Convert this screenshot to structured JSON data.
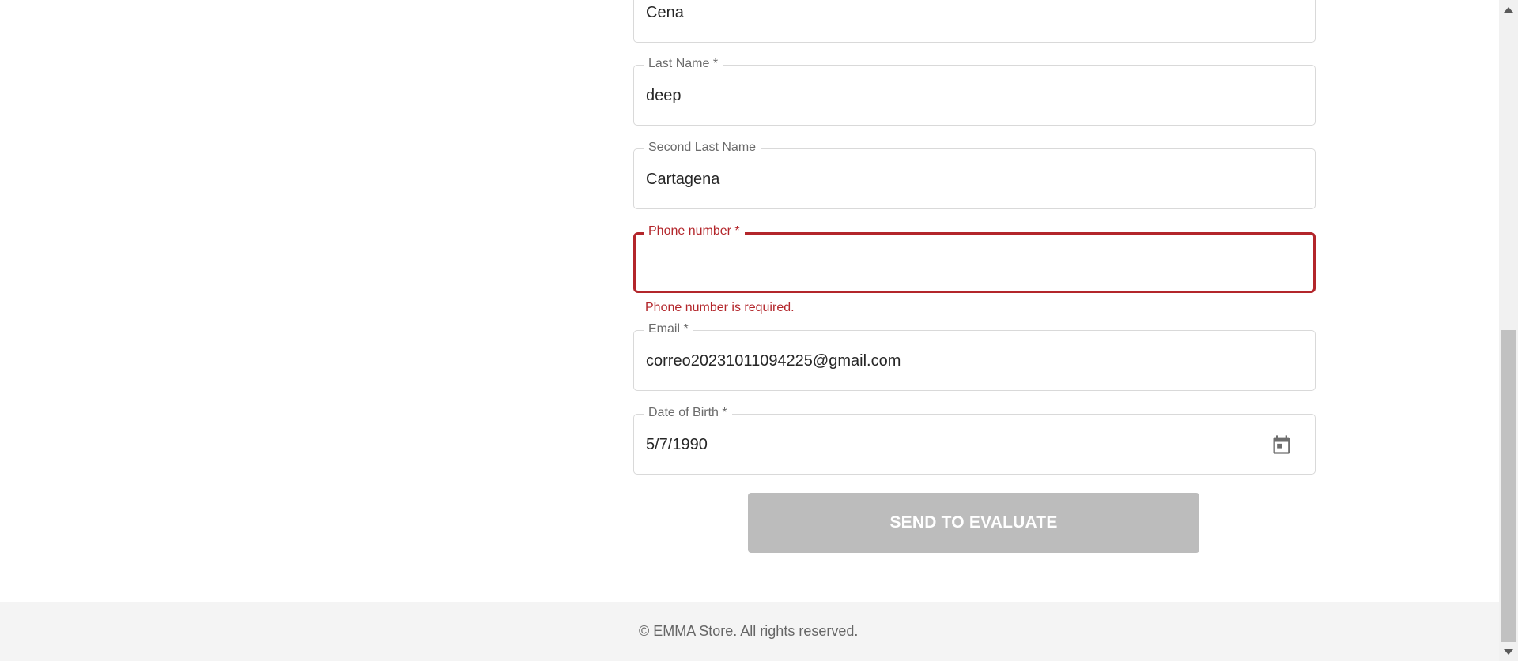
{
  "form": {
    "first_name": {
      "value": "Cena"
    },
    "last_name": {
      "label": "Last Name *",
      "value": "deep"
    },
    "second_last_name": {
      "label": "Second Last Name",
      "value": "Cartagena"
    },
    "phone_number": {
      "label": "Phone number *",
      "value": "",
      "error": "Phone number is required."
    },
    "email": {
      "label": "Email *",
      "value": "correo20231011094225@gmail.com"
    },
    "date_of_birth": {
      "label": "Date of Birth *",
      "value": "5/7/1990",
      "icon": "calendar-icon"
    },
    "submit_label": "SEND TO EVALUATE"
  },
  "footer": {
    "text": "© EMMA Store. All rights reserved."
  },
  "colors": {
    "error": "#b3262b",
    "border": "#d9d9d9",
    "button_disabled": "#bcbcbc",
    "footer_bg": "#f4f4f4"
  }
}
